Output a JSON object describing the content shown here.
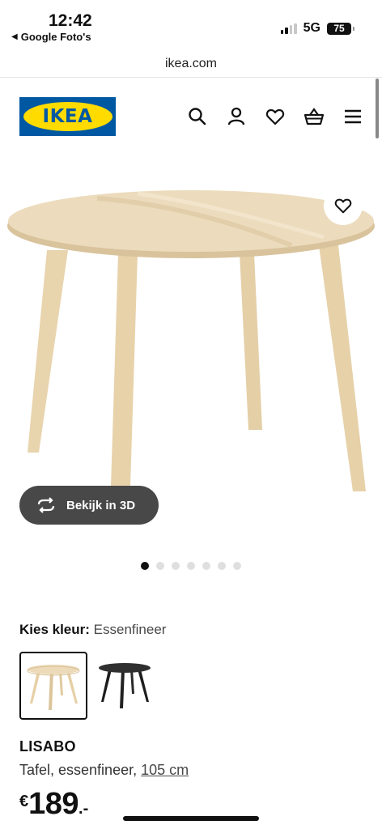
{
  "status_bar": {
    "time": "12:42",
    "back_app": "Google Foto's",
    "network": "5G",
    "battery": "75"
  },
  "browser": {
    "url": "ikea.com"
  },
  "header": {
    "logo_text": "IKEA",
    "icons": [
      "search-icon",
      "user-icon",
      "heart-icon",
      "basket-icon",
      "menu-icon"
    ]
  },
  "product": {
    "view_3d_label": "Bekijk in 3D",
    "image_count": 7,
    "active_image": 1,
    "color_label": "Kies kleur:",
    "color_value": "Essenfineer",
    "swatches": [
      {
        "name": "Essenfineer",
        "selected": true,
        "color": "#e8d3ad"
      },
      {
        "name": "zwart",
        "selected": false,
        "color": "#2a2a2a"
      }
    ],
    "name": "LISABO",
    "description": "Tafel, essenfineer,",
    "size": "105 cm",
    "price": {
      "currency": "€",
      "amount": "189",
      "decimals": ".-"
    }
  },
  "colors": {
    "brand_blue": "#0058a3",
    "brand_yellow": "#ffdb00",
    "wood": "#ead8b4"
  }
}
